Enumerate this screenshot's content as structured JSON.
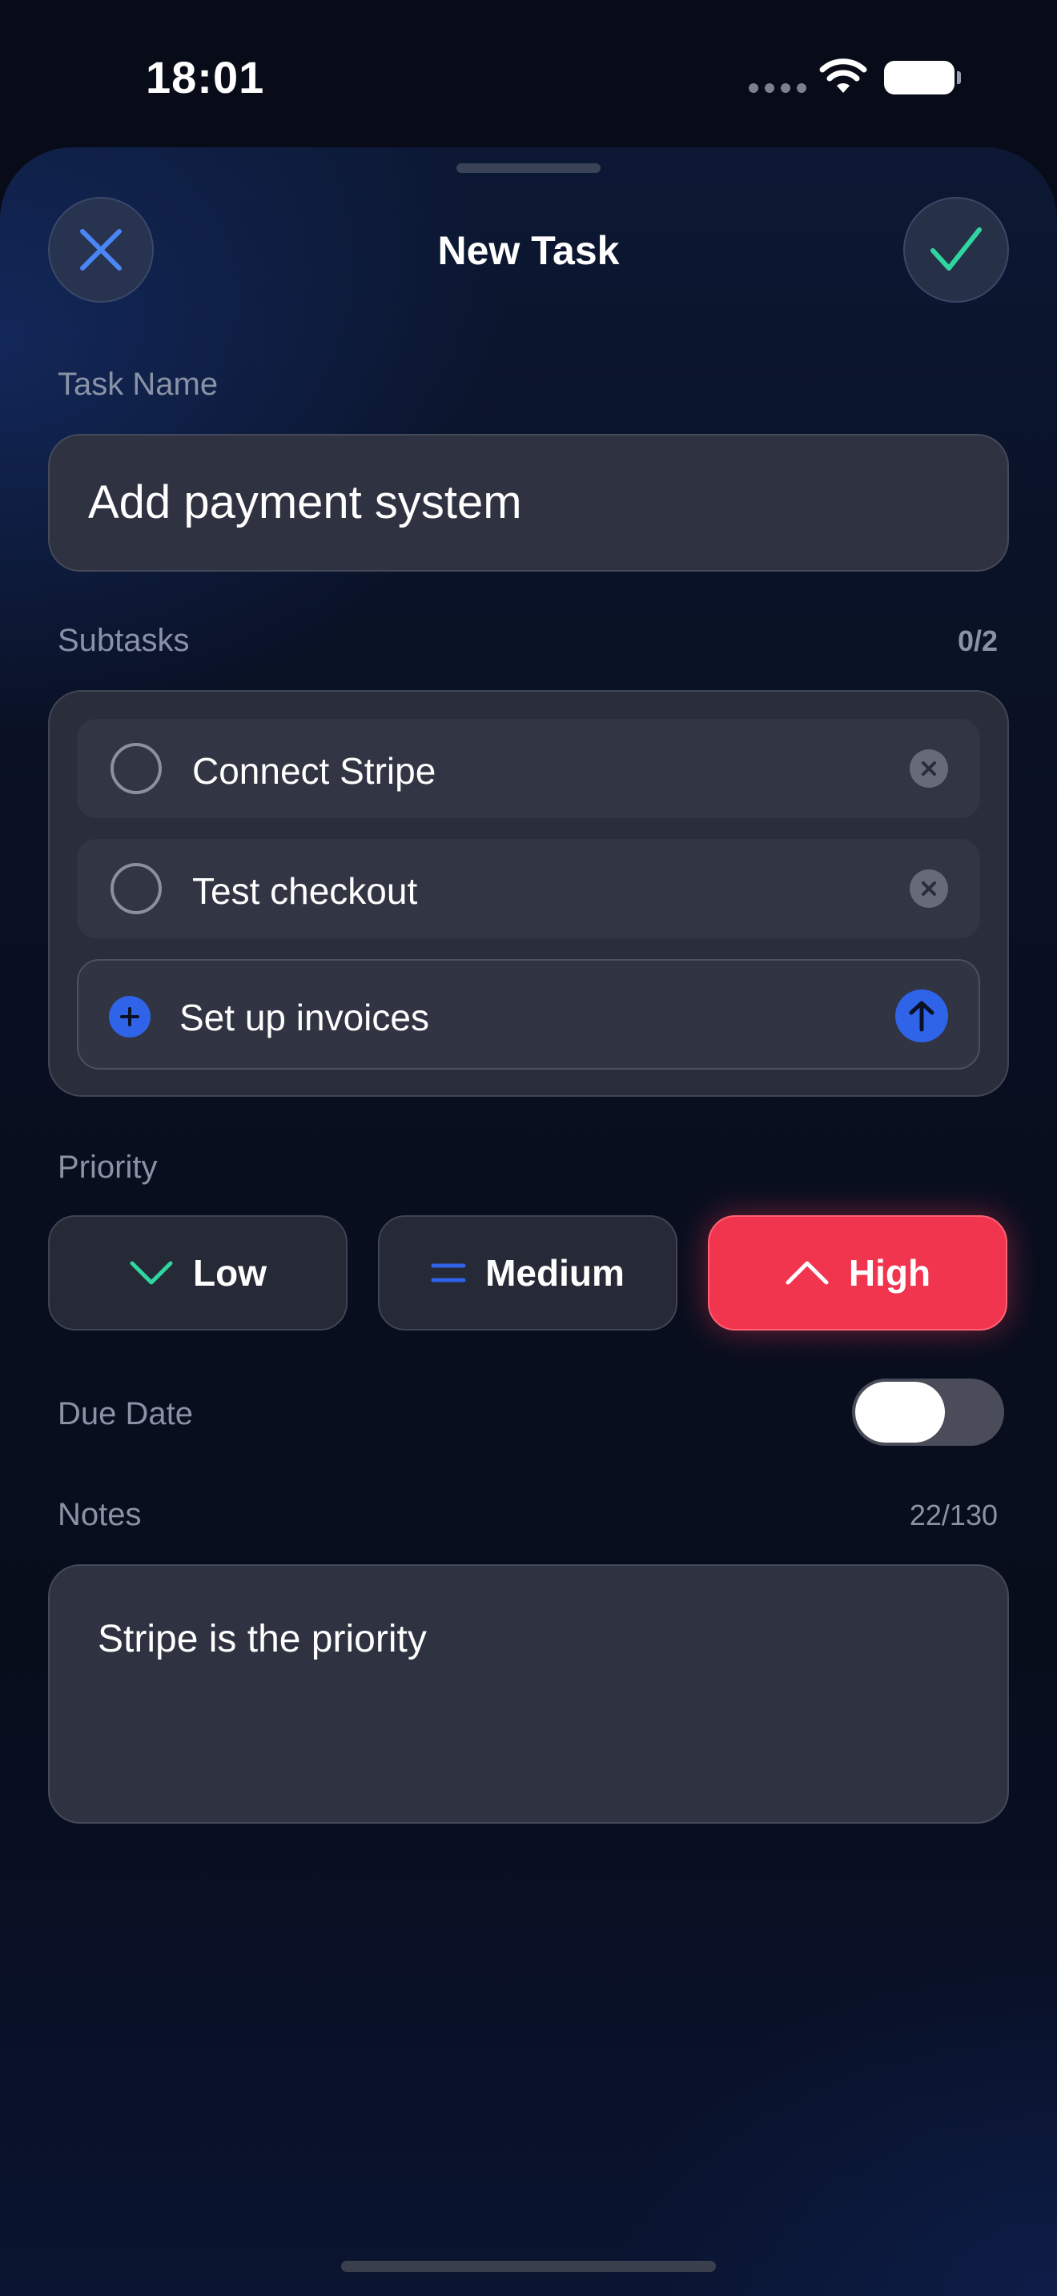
{
  "status_bar": {
    "time": "18:01"
  },
  "sheet": {
    "title": "New Task"
  },
  "task_name": {
    "label": "Task Name",
    "value": "Add payment system"
  },
  "subtasks": {
    "label": "Subtasks",
    "count": "0/2",
    "items": [
      {
        "label": "Connect Stripe",
        "completed": false
      },
      {
        "label": "Test checkout",
        "completed": false
      }
    ],
    "new_item_value": "Set up invoices"
  },
  "priority": {
    "label": "Priority",
    "options": [
      {
        "label": "Low",
        "icon": "chevron-down-icon",
        "color": "#2fd6a0"
      },
      {
        "label": "Medium",
        "icon": "equals-icon",
        "color": "#2f63e8"
      },
      {
        "label": "High",
        "icon": "chevron-up-icon",
        "color": "#f2354f"
      }
    ],
    "selected": "High"
  },
  "due_date": {
    "label": "Due Date",
    "enabled": false
  },
  "notes": {
    "label": "Notes",
    "count": "22/130",
    "value": "Stripe is the priority"
  },
  "colors": {
    "accent_blue": "#2f63e8",
    "accent_green": "#2fd6a0",
    "accent_red": "#f2354f"
  }
}
